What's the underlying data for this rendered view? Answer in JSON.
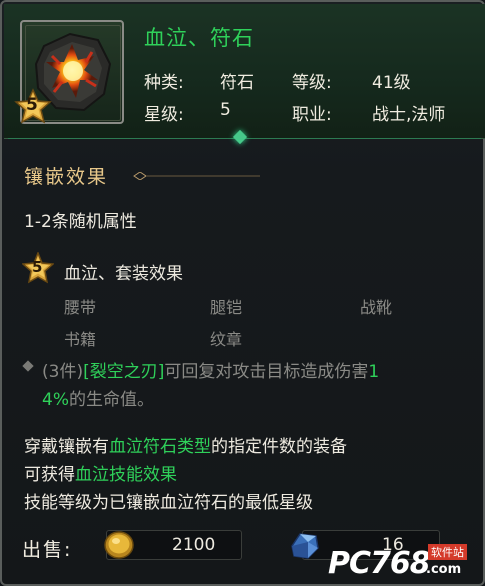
{
  "item": {
    "name": "血泣、符石",
    "star_level_badge": "5",
    "type_label": "种类:",
    "type_value": "符石",
    "level_label": "等级:",
    "level_value": "41级",
    "star_label": "星级:",
    "star_value": "5",
    "class_label": "职业:",
    "class_value": "战士,法师"
  },
  "inlay": {
    "title": "镶嵌效果",
    "random_attr": "1-2条随机属性",
    "set_badge": "5",
    "set_title": "血泣、套装效果",
    "set_items": [
      "腰带",
      "腿铠",
      "战靴",
      "书籍",
      "纹章"
    ],
    "bonus_prefix": "(3件)",
    "bonus_skill": "[裂空之刃]",
    "bonus_text_1": "可回复对攻击目标造成伤害",
    "bonus_percent_1": "1",
    "bonus_percent_2": "4%",
    "bonus_text_2": "的生命值。"
  },
  "description": {
    "line1_a": "穿戴镶嵌有",
    "line1_b": "血泣符石类型",
    "line1_c": "的指定件数的装备",
    "line2_a": "可获得",
    "line2_b": "血泣技能效果",
    "line3": "技能等级为已镶嵌血泣符石的最低星级"
  },
  "sell": {
    "label": "出售:",
    "gold": "2100",
    "crystal": "16"
  },
  "watermark": {
    "brand": "PC768",
    "domain": ".com",
    "tag": "软件站"
  },
  "colors": {
    "name_green": "#2fd15a",
    "section_gold": "#e8c88a",
    "muted": "#8a8a86",
    "badge_gold": "#d9a43a"
  }
}
